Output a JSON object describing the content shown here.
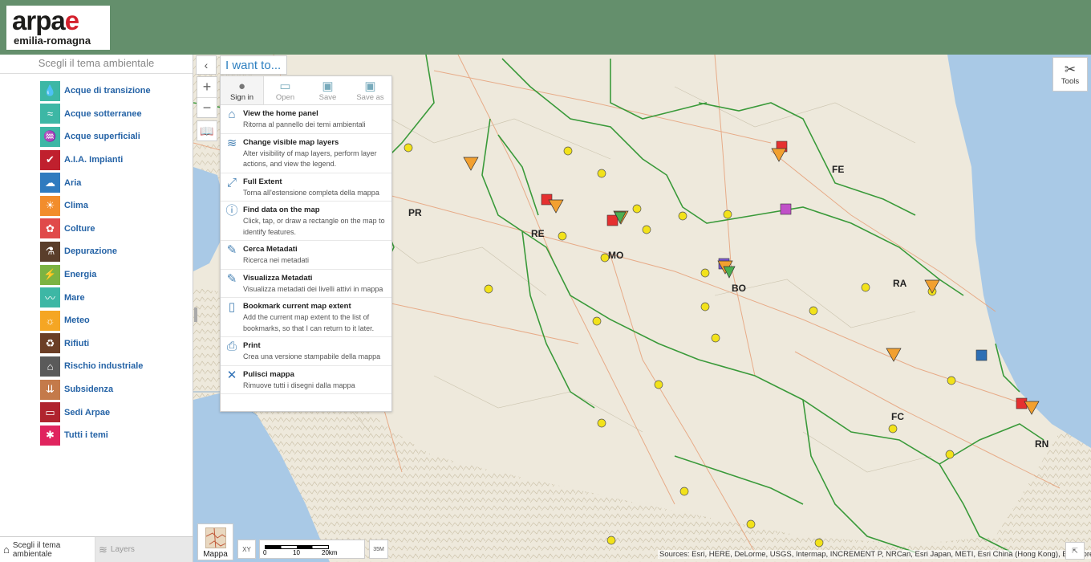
{
  "logo": {
    "name": "arpae",
    "name_main": "arpa",
    "name_accent": "e",
    "region": "emilia-romagna"
  },
  "sidebar": {
    "title": "Scegli il tema ambientale",
    "themes": [
      {
        "label": "Acque di transizione",
        "color": "#3db7a5",
        "icon": "water-drop-icon"
      },
      {
        "label": "Acque sotterranee",
        "color": "#3db7a5",
        "icon": "groundwater-icon"
      },
      {
        "label": "Acque superficiali",
        "color": "#3db7a5",
        "icon": "river-icon"
      },
      {
        "label": "A.I.A. Impianti",
        "color": "#c0202e",
        "icon": "check-shield-icon"
      },
      {
        "label": "Aria",
        "color": "#2f7bbf",
        "icon": "air-icon"
      },
      {
        "label": "Clima",
        "color": "#f28d2c",
        "icon": "climate-icon"
      },
      {
        "label": "Colture",
        "color": "#e04a4a",
        "icon": "crops-icon"
      },
      {
        "label": "Depurazione",
        "color": "#5a3e2b",
        "icon": "purification-icon"
      },
      {
        "label": "Energia",
        "color": "#7cb342",
        "icon": "energy-icon"
      },
      {
        "label": "Mare",
        "color": "#3db7a5",
        "icon": "sea-icon"
      },
      {
        "label": "Meteo",
        "color": "#f5a623",
        "icon": "weather-icon"
      },
      {
        "label": "Rifiuti",
        "color": "#6b3e26",
        "icon": "waste-icon"
      },
      {
        "label": "Rischio industriale",
        "color": "#5a5a5a",
        "icon": "factory-icon"
      },
      {
        "label": "Subsidenza",
        "color": "#c47a4a",
        "icon": "subsidence-icon"
      },
      {
        "label": "Sedi Arpae",
        "color": "#b0242e",
        "icon": "map-icon"
      },
      {
        "label": "Tutti i temi",
        "color": "#e0245e",
        "icon": "all-themes-icon"
      }
    ],
    "tabs": {
      "themes": "Scegli il tema ambientale",
      "layers": "Layers"
    }
  },
  "map": {
    "iwant_label": "I want to...",
    "panel": {
      "toolbar": [
        {
          "label": "Sign in",
          "icon": "user-icon"
        },
        {
          "label": "Open",
          "icon": "folder-icon"
        },
        {
          "label": "Save",
          "icon": "save-icon"
        },
        {
          "label": "Save as",
          "icon": "save-as-icon"
        }
      ],
      "items": [
        {
          "title": "View the home panel",
          "desc": "Ritorna al pannello dei temi ambientali",
          "icon": "home-icon"
        },
        {
          "title": "Change visible map layers",
          "desc": "Alter visibility of map layers, perform layer actions, and view the legend.",
          "icon": "layers-icon"
        },
        {
          "title": "Full Extent",
          "desc": "Torna all'estensione completa della mappa",
          "icon": "full-extent-icon"
        },
        {
          "title": "Find data on the map",
          "desc": "Click, tap, or draw a rectangle on the map to identify features.",
          "icon": "identify-icon"
        },
        {
          "title": "Cerca Metadati",
          "desc": "Ricerca nei metadati",
          "icon": "pencil-icon"
        },
        {
          "title": "Visualizza Metadati",
          "desc": "Visualizza metadati dei livelli attivi in mappa",
          "icon": "pencil-icon"
        },
        {
          "title": "Bookmark current map extent",
          "desc": "Add the current map extent to the list of bookmarks, so that I can return to it later.",
          "icon": "book-icon"
        },
        {
          "title": "Print",
          "desc": "Crea una versione stampabile della mappa",
          "icon": "printer-icon"
        },
        {
          "title": "Pulisci mappa",
          "desc": "Rimuove tutti i disegni dalla mappa",
          "icon": "clear-icon"
        }
      ]
    },
    "tools_label": "Tools",
    "basemap_label": "Mappa",
    "scale": {
      "t0": "0",
      "t1": "10",
      "t2": "20km"
    },
    "coord_label": "XY",
    "sm_label": "35M",
    "attribution": "Sources: Esri, HERE, DeLorme, USGS, Intermap, INCREMENT P, NRCan, Esri Japan, METI, Esri China (Hong Kong), Esri Korea...",
    "provinces": [
      "PR",
      "RE",
      "MO",
      "BO",
      "FE",
      "RA",
      "FC",
      "RN"
    ],
    "colors": {
      "sea": "#a9c9e6",
      "land": "#eee9dc",
      "border": "#3a9a3a",
      "marker_t": "#f2e21a",
      "marker_a": "#e53030",
      "marker_s": "#f2a030",
      "marker_d": "#4caf50"
    }
  }
}
